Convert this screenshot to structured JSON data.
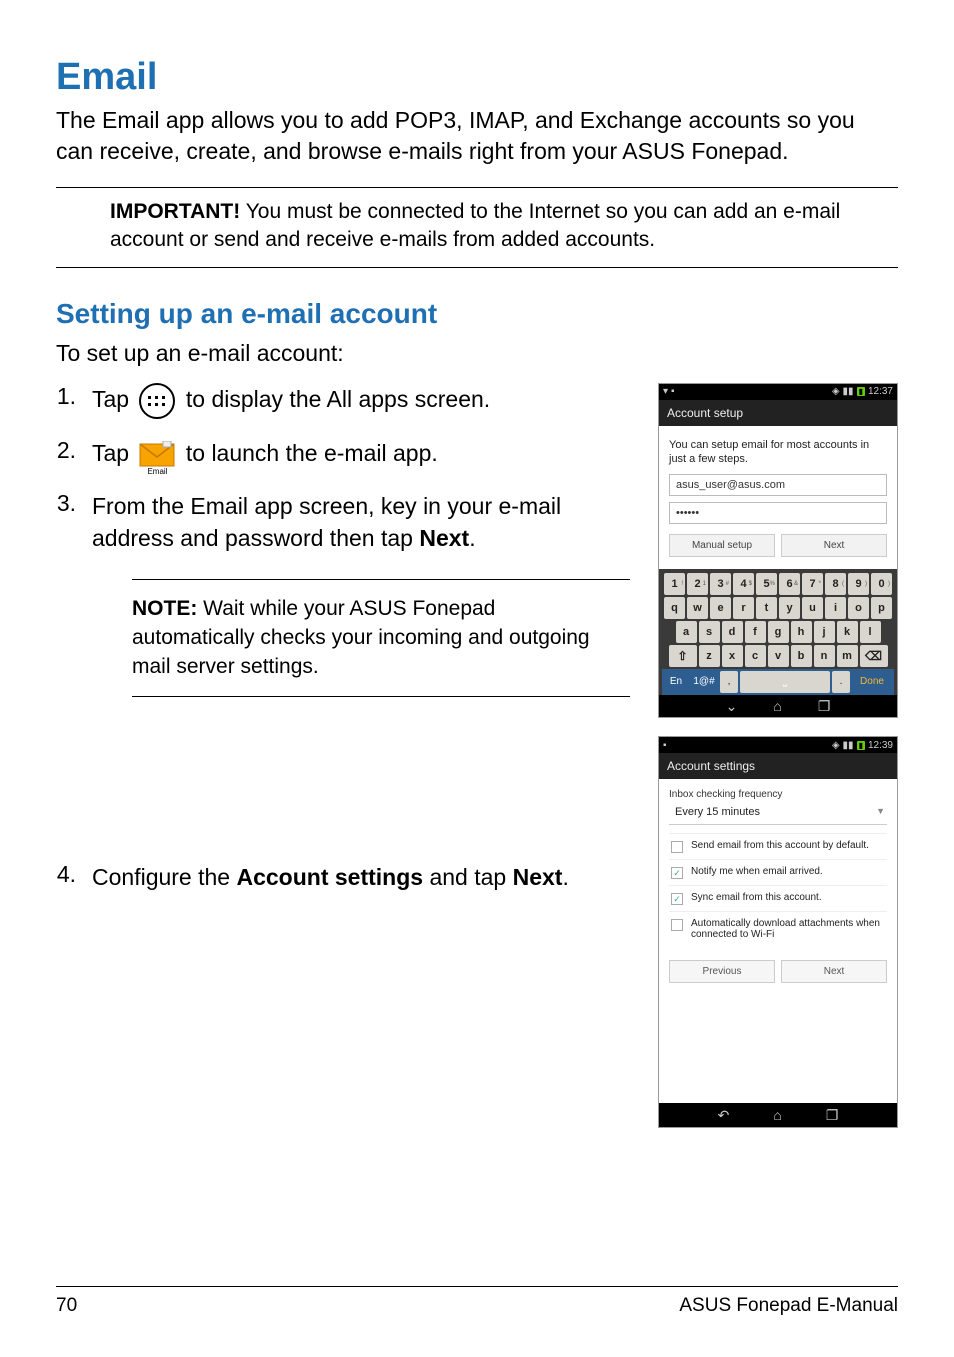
{
  "title": "Email",
  "intro": "The Email app allows you to add POP3, IMAP, and Exchange accounts so you can receive, create, and browse e-mails right from your ASUS Fonepad.",
  "important_label": "IMPORTANT!",
  "important_text": " You must be connected to the Internet so you can add an e-mail account or send and receive e-mails from added accounts.",
  "subheading": "Setting up an e-mail account",
  "lead": "To set up an e-mail account:",
  "steps": {
    "s1_pre": "Tap ",
    "s1_post": " to display the All apps screen.",
    "s2_pre": "Tap ",
    "s2_post": " to launch the e-mail app.",
    "s2_icon_label": "Email",
    "s3_a": "From the Email app screen, key in your e-mail address and password then tap ",
    "s3_bold": "Next",
    "s3_b": ".",
    "note_label": "NOTE:",
    "note_text": " Wait while your ASUS Fonepad automatically checks your incoming and outgoing mail server settings.",
    "s4_a": "Configure the ",
    "s4_bold1": "Account settings",
    "s4_b": " and tap ",
    "s4_bold2": "Next",
    "s4_c": "."
  },
  "mock1": {
    "time": "12:37",
    "header": "Account setup",
    "desc": "You can setup email for most accounts in just a few steps.",
    "email_value": "asus_user@asus.com",
    "pwd_value": "••••••",
    "btn_manual": "Manual setup",
    "btn_next": "Next",
    "kbd_row1": [
      "1",
      "2",
      "3",
      "4",
      "5",
      "6",
      "7",
      "8",
      "9",
      "0"
    ],
    "kbd_row1_sup": [
      "!",
      "1",
      "#",
      "$",
      "%",
      "&",
      "*",
      "(",
      ")",
      ")"
    ],
    "kbd_row2": [
      "q",
      "w",
      "e",
      "r",
      "t",
      "y",
      "u",
      "i",
      "o",
      "p"
    ],
    "kbd_row3": [
      "a",
      "s",
      "d",
      "f",
      "g",
      "h",
      "j",
      "k",
      "l"
    ],
    "kbd_row4": [
      "z",
      "x",
      "c",
      "v",
      "b",
      "n",
      "m"
    ],
    "kbd_en": "En",
    "kbd_sym": "1@#",
    "kbd_done": "Done"
  },
  "mock2": {
    "time": "12:39",
    "header": "Account settings",
    "freq_label": "Inbox checking frequency",
    "freq_value": "Every 15 minutes",
    "opt1": "Send email from this account by default.",
    "opt2": "Notify me when email arrived.",
    "opt3": "Sync email from this account.",
    "opt4": "Automatically download attachments when connected to Wi-Fi",
    "btn_prev": "Previous",
    "btn_next": "Next"
  },
  "footer": {
    "page": "70",
    "doc": "ASUS Fonepad E-Manual"
  }
}
